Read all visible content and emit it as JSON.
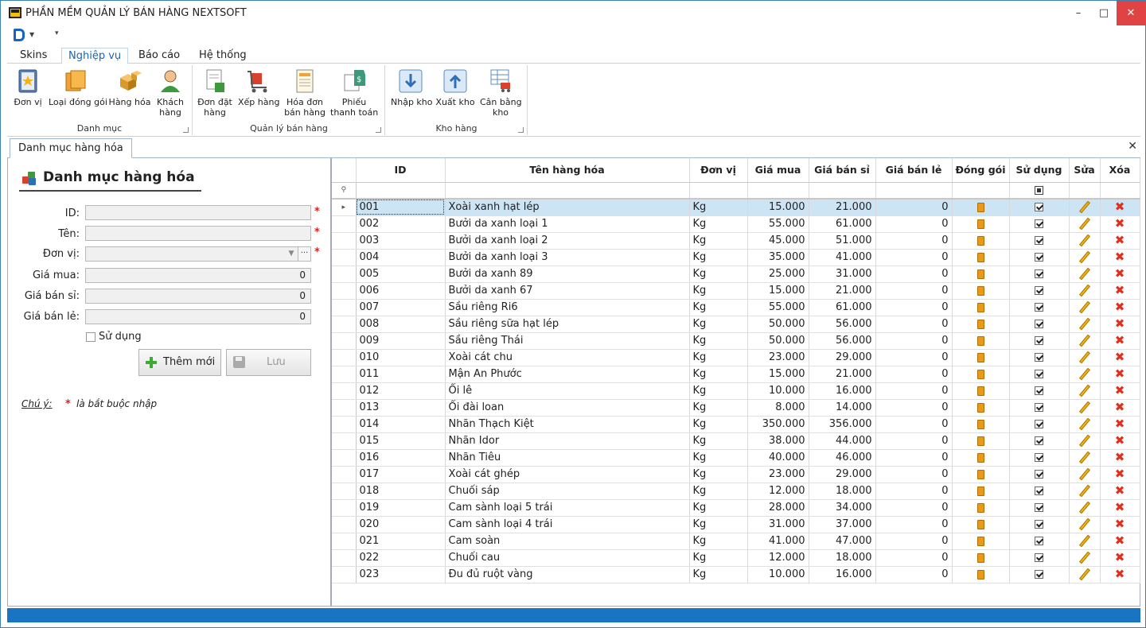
{
  "window": {
    "title": "PHẦN MỀM QUẢN LÝ BÁN HÀNG NEXTSOFT",
    "min": "–",
    "max": "□",
    "close": "✕"
  },
  "ribbon": {
    "tabs": [
      {
        "label": "Skins"
      },
      {
        "label": "Nghiệp vụ"
      },
      {
        "label": "Báo cáo"
      },
      {
        "label": "Hệ thống"
      }
    ],
    "groups": [
      {
        "label": "Danh mục"
      },
      {
        "label": "Quản lý bán hàng"
      },
      {
        "label": "Kho hàng"
      }
    ],
    "buttons": [
      {
        "label": "Đơn vị"
      },
      {
        "label": "Loại đóng gói"
      },
      {
        "label": "Hàng hóa"
      },
      {
        "label": "Khách\nhàng"
      },
      {
        "label": "Đơn đặt\nhàng"
      },
      {
        "label": "Xếp hàng"
      },
      {
        "label": "Hóa đơn\nbán hàng"
      },
      {
        "label": "Phiếu\nthanh toán"
      },
      {
        "label": "Nhập kho"
      },
      {
        "label": "Xuất kho"
      },
      {
        "label": "Cân bằng\nkho"
      }
    ]
  },
  "doctab": {
    "label": "Danh mục hàng hóa",
    "close": "✕"
  },
  "form": {
    "title": "Danh mục hàng hóa",
    "fields": [
      {
        "label": "ID:",
        "value": "",
        "required": true
      },
      {
        "label": "Tên:",
        "value": "",
        "required": true
      },
      {
        "label": "Đơn vị:",
        "value": "",
        "required": true
      },
      {
        "label": "Giá mua:",
        "value": "0"
      },
      {
        "label": "Giá bán sỉ:",
        "value": "0"
      },
      {
        "label": "Giá bán lẻ:",
        "value": "0"
      }
    ],
    "required_mark": "*",
    "combo_button": "···",
    "use_label": "Sử dụng",
    "add_button": "Thêm mới",
    "save_button": "Lưu",
    "note_label": "Chú ý:",
    "note_star": "*",
    "note_text": "là bắt buộc nhập"
  },
  "grid": {
    "columns": [
      "ID",
      "Tên hàng hóa",
      "Đơn vị",
      "Giá mua",
      "Giá bán sỉ",
      "Giá bán lẻ",
      "Đóng gói",
      "Sử dụng",
      "Sửa",
      "Xóa"
    ],
    "rows": [
      [
        "001",
        "Xoài xanh hạt lép",
        "Kg",
        "15.000",
        "21.000",
        "0"
      ],
      [
        "002",
        "Bưởi da xanh loại 1",
        "Kg",
        "55.000",
        "61.000",
        "0"
      ],
      [
        "003",
        "Bưởi da xanh loại 2",
        "Kg",
        "45.000",
        "51.000",
        "0"
      ],
      [
        "004",
        "Bưởi da xanh loại 3",
        "Kg",
        "35.000",
        "41.000",
        "0"
      ],
      [
        "005",
        "Bưởi da xanh 89",
        "Kg",
        "25.000",
        "31.000",
        "0"
      ],
      [
        "006",
        "Bưởi da xanh 67",
        "Kg",
        "15.000",
        "21.000",
        "0"
      ],
      [
        "007",
        "Sầu riêng Ri6",
        "Kg",
        "55.000",
        "61.000",
        "0"
      ],
      [
        "008",
        "Sầu riêng sữa hạt lép",
        "Kg",
        "50.000",
        "56.000",
        "0"
      ],
      [
        "009",
        "Sầu riêng Thái",
        "Kg",
        "50.000",
        "56.000",
        "0"
      ],
      [
        "010",
        "Xoài cát chu",
        "Kg",
        "23.000",
        "29.000",
        "0"
      ],
      [
        "011",
        "Mận An Phước",
        "Kg",
        "15.000",
        "21.000",
        "0"
      ],
      [
        "012",
        "Ổi lê",
        "Kg",
        "10.000",
        "16.000",
        "0"
      ],
      [
        "013",
        "Ổi đài loan",
        "Kg",
        "8.000",
        "14.000",
        "0"
      ],
      [
        "014",
        "Nhãn Thạch Kiệt",
        "Kg",
        "350.000",
        "356.000",
        "0"
      ],
      [
        "015",
        "Nhãn Idor",
        "Kg",
        "38.000",
        "44.000",
        "0"
      ],
      [
        "016",
        "Nhãn Tiêu",
        "Kg",
        "40.000",
        "46.000",
        "0"
      ],
      [
        "017",
        "Xoài cát ghép",
        "Kg",
        "23.000",
        "29.000",
        "0"
      ],
      [
        "018",
        "Chuối sáp",
        "Kg",
        "12.000",
        "18.000",
        "0"
      ],
      [
        "019",
        "Cam sành loại 5 trái",
        "Kg",
        "28.000",
        "34.000",
        "0"
      ],
      [
        "020",
        "Cam sành loại 4 trái",
        "Kg",
        "31.000",
        "37.000",
        "0"
      ],
      [
        "021",
        "Cam soàn",
        "Kg",
        "41.000",
        "47.000",
        "0"
      ],
      [
        "022",
        "Chuối cau",
        "Kg",
        "12.000",
        "18.000",
        "0"
      ],
      [
        "023",
        "Đu đủ ruột vàng",
        "Kg",
        "10.000",
        "16.000",
        "0"
      ]
    ],
    "selected_row": 0
  }
}
